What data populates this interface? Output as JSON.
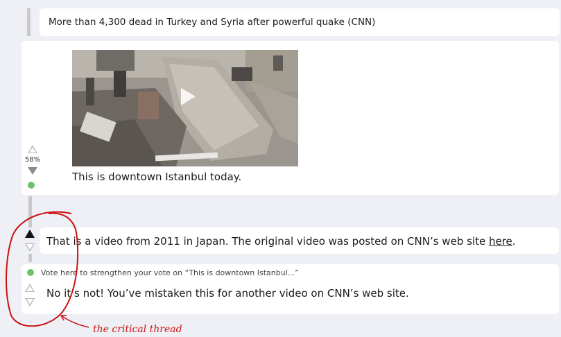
{
  "parent_post": {
    "text": "More than 4,300 dead in Turkey and Syria after powerful quake (CNN)"
  },
  "main_post": {
    "vote_percent": "58%",
    "video_thumbnail": "earthquake-rubble-video",
    "caption": "This is downtown Istanbul today."
  },
  "reply1": {
    "text_before": "That is a video from 2011 in Japan. The original video was posted on CNN’s web site ",
    "link_text": "here",
    "text_after": "."
  },
  "reply2": {
    "vote_hint": "Vote here to strengthen your vote on “This is downtown Istanbul...”",
    "text": "No it’s not! You’ve mistaken this for another video on CNN’s web site."
  },
  "annotation": {
    "label": "the critical thread",
    "color": "#cc1111"
  },
  "colors": {
    "green_dot": "#6ec26e",
    "background": "#eef0f5"
  }
}
